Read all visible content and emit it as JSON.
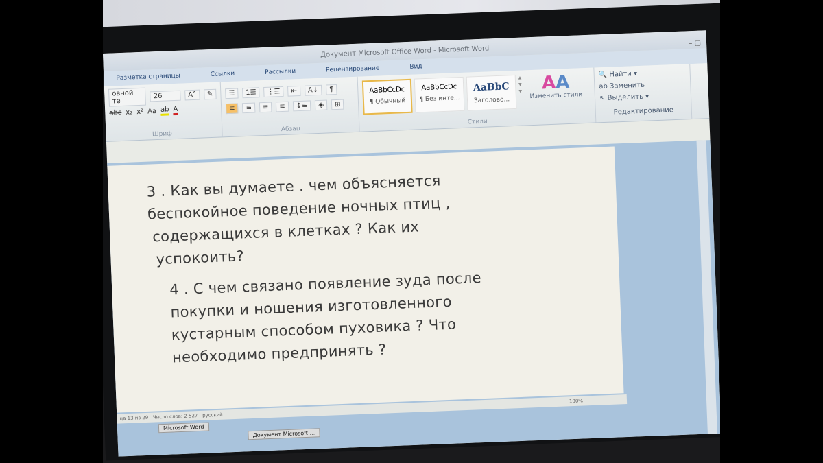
{
  "window": {
    "title": "Документ Microsoft Office Word - Microsoft Word"
  },
  "ribbon": {
    "tabs": [
      "Разметка страницы",
      "Ссылки",
      "Рассылки",
      "Рецензирование",
      "Вид"
    ],
    "font": {
      "name": "овной те",
      "size": "26",
      "label": "Шрифт"
    },
    "paragraph": {
      "label": "Абзац"
    },
    "styles": {
      "label": "Стили",
      "items": [
        {
          "preview": "AaBbCcDc",
          "name": "¶ Обычный",
          "selected": true
        },
        {
          "preview": "AaBbCcDc",
          "name": "¶ Без инте...",
          "selected": false
        },
        {
          "preview": "AaBbC",
          "name": "Заголово...",
          "selected": false
        }
      ],
      "change_styles": "Изменить стили"
    },
    "editing": {
      "label": "Редактирование",
      "find": "Найти",
      "replace": "Заменить",
      "select": "Выделить"
    }
  },
  "document": {
    "paragraphs": [
      [
        "3 . Как вы думаете . чем объясняется",
        "беспокойное поведение ночных птиц ,",
        "содержащихся  в клетках ? Как их",
        "успокоить?"
      ],
      [
        "4 . С чем связано появление зуда после",
        "покупки и ношения изготовленного",
        "кустарным способом пуховика ? Что",
        "необходимо предпринять ?"
      ]
    ]
  },
  "status": {
    "page": "ца 13 из 29",
    "words": "Число слов: 2 527",
    "language": "русский",
    "zoom": "100%"
  },
  "taskbar": {
    "items": [
      "Microsoft Word",
      "Документ Microsoft ..."
    ]
  }
}
